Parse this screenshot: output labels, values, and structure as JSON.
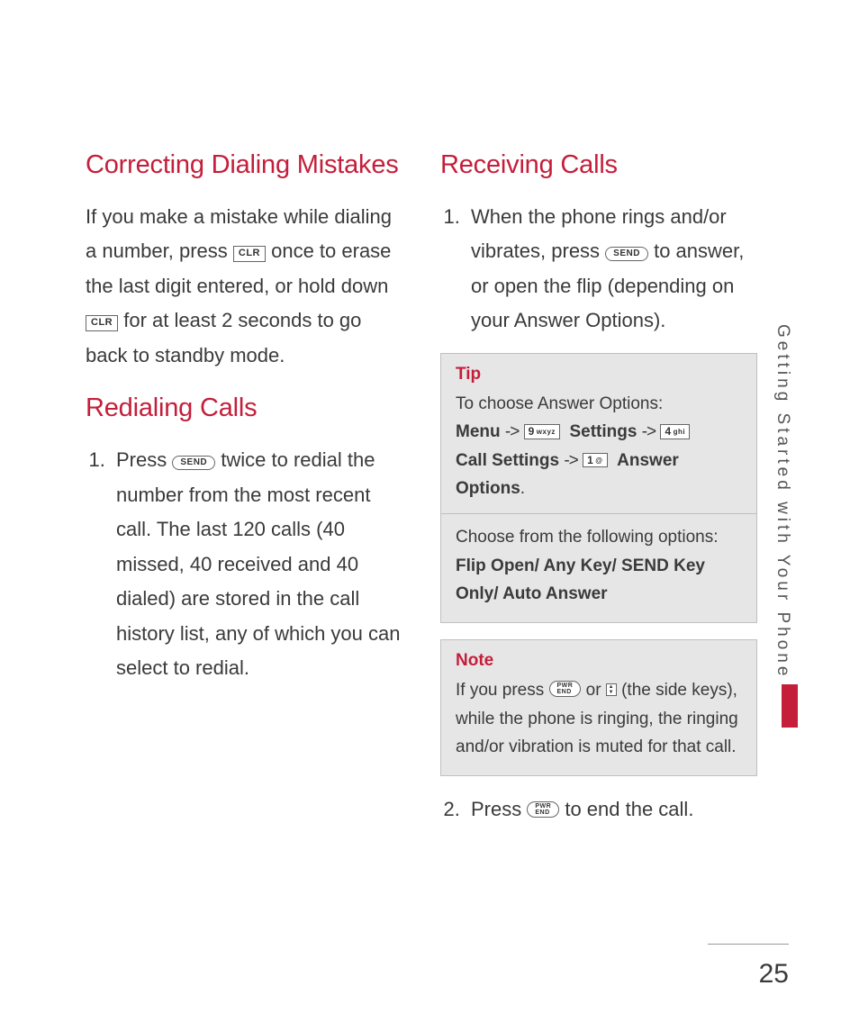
{
  "side_tab": "Getting Started with Your Phone",
  "page_number": "25",
  "left": {
    "h_correcting": "Correcting Dialing Mistakes",
    "p_correcting_1": "If you make a mistake while dialing a number, press ",
    "p_correcting_2": " once to erase the last digit entered, or hold down ",
    "p_correcting_3": " for at least 2 seconds to go back to standby mode.",
    "h_redial": "Redialing Calls",
    "redial_1a": "Press ",
    "redial_1b": " twice to redial the number from the most recent call. The last 120 calls (40 missed, 40 received and 40 dialed) are stored in the call history list, any of which you can select to redial."
  },
  "right": {
    "h_receiving": "Receiving Calls",
    "recv_1a": "When the phone rings and/or vibrates, press ",
    "recv_1b": " to answer, or open the flip (depending on your Answer Options).",
    "tip_title": "Tip",
    "tip_line1": "To choose Answer Options:",
    "tip_menu": "Menu",
    "tip_settings": "Settings",
    "tip_call_settings": "Call Settings",
    "tip_answer_opts": "Answer Options",
    "tip_arrow": "->",
    "tip_choose": "Choose from the following options:",
    "tip_options_bold": "Flip Open/ Any Key/ SEND Key Only/ Auto Answer",
    "note_title": "Note",
    "note_1a": "If you press ",
    "note_or": " or ",
    "note_1b": " (the side keys), while the phone is ringing, the ringing and/or vibration is muted for that call.",
    "recv_2a": "Press ",
    "recv_2b": " to end the call."
  },
  "keys": {
    "clr": "CLR",
    "send": "SEND",
    "end_top": "PWR",
    "end_bot": "END",
    "k9": "9",
    "k9sub": "wxyz",
    "k4": "4",
    "k4sub": "ghi",
    "k1": "1",
    "k1sub": "@"
  }
}
